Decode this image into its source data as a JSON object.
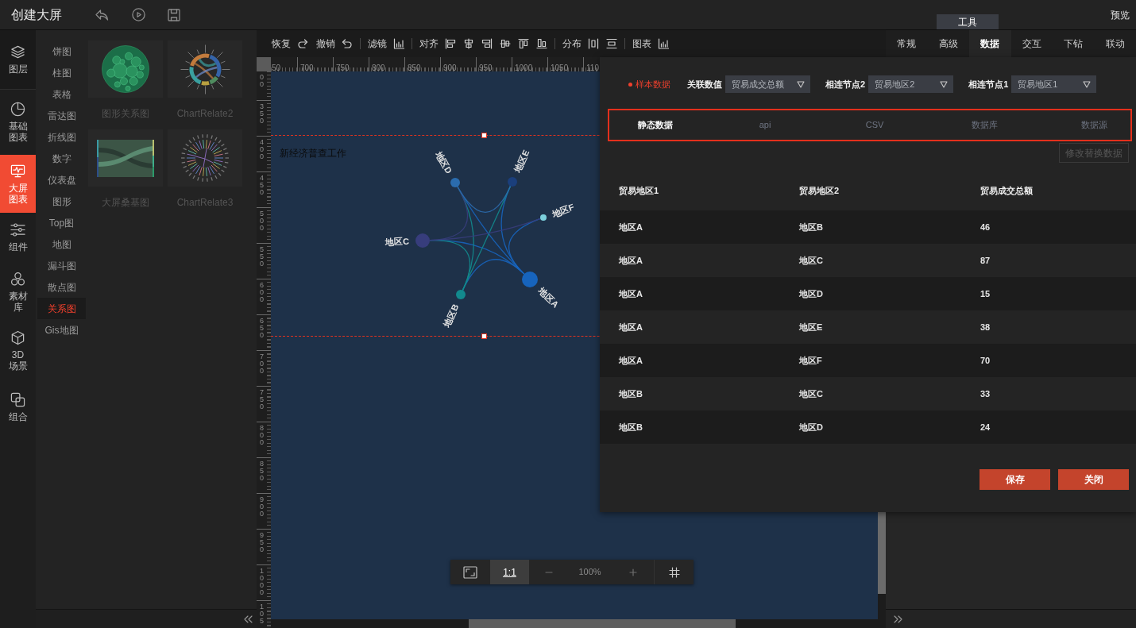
{
  "header": {
    "title": "创建大屏",
    "tool_tab": "工具",
    "preview": "预览"
  },
  "rail": [
    {
      "label": "图层",
      "selected": false
    },
    {
      "label": "基础图表",
      "selected": false
    },
    {
      "label": "大屏图表",
      "selected": true
    },
    {
      "label": "组件",
      "selected": false
    },
    {
      "label": "素材库",
      "selected": false
    },
    {
      "label": "3D场景",
      "selected": false
    },
    {
      "label": "组合",
      "selected": false
    }
  ],
  "categories": [
    {
      "label": "饼图",
      "selected": false
    },
    {
      "label": "柱图",
      "selected": false
    },
    {
      "label": "表格",
      "selected": false
    },
    {
      "label": "雷达图",
      "selected": false
    },
    {
      "label": "折线图",
      "selected": false
    },
    {
      "label": "数字",
      "selected": false
    },
    {
      "label": "仪表盘",
      "selected": false
    },
    {
      "label": "图形",
      "selected": false
    },
    {
      "label": "Top图",
      "selected": false
    },
    {
      "label": "地图",
      "selected": false
    },
    {
      "label": "漏斗图",
      "selected": false
    },
    {
      "label": "散点图",
      "selected": false
    },
    {
      "label": "关系图",
      "selected": true
    },
    {
      "label": "Gis地图",
      "selected": false
    }
  ],
  "templates": [
    {
      "name": "图形关系图"
    },
    {
      "name": "ChartRelate2"
    },
    {
      "name": "大屏桑基图"
    },
    {
      "name": "ChartRelate3"
    }
  ],
  "toolbar": [
    {
      "label": "恢复"
    },
    {
      "label": "撤销"
    },
    {
      "label": "滤镜"
    },
    {
      "label": "对齐"
    },
    {
      "label": "分布"
    },
    {
      "label": "图表"
    }
  ],
  "property_tabs": [
    {
      "label": "常规",
      "selected": false
    },
    {
      "label": "高级",
      "selected": false
    },
    {
      "label": "数据",
      "selected": true
    },
    {
      "label": "交互",
      "selected": false
    },
    {
      "label": "下钻",
      "selected": false
    },
    {
      "label": "联动",
      "selected": false
    }
  ],
  "rulers": {
    "x_labels": [
      "50",
      "700",
      "750",
      "800",
      "850",
      "900",
      "950",
      "1000",
      "1050",
      "110"
    ],
    "y_labels": [
      "00",
      "350",
      "400",
      "450",
      "500",
      "550",
      "600",
      "650",
      "700",
      "750",
      "800",
      "850",
      "900",
      "950",
      "1000",
      "105"
    ]
  },
  "canvas": {
    "label": "新经济普查工作",
    "graph": {
      "nodes": [
        {
          "label": "地区D",
          "color": "#2b6cae"
        },
        {
          "label": "地区E",
          "color": "#1b3f7c"
        },
        {
          "label": "地区F",
          "color": "#7ccfdc"
        },
        {
          "label": "地区C",
          "color": "#373d7c"
        },
        {
          "label": "地区A",
          "color": "#1764bd"
        },
        {
          "label": "地区B",
          "color": "#12898d"
        }
      ]
    }
  },
  "zoom_bar": {
    "actual_size": {
      "label": "1:1",
      "active": true
    },
    "zoom": "100%"
  },
  "data_panel": {
    "sample_tag": "样本数据",
    "fields": [
      {
        "label": "关联数值",
        "value": "贸易成交总额"
      },
      {
        "label": "相连节点2",
        "value": "贸易地区2"
      },
      {
        "label": "相连节点1",
        "value": "贸易地区1"
      }
    ],
    "source_tabs": [
      {
        "label": "静态数据",
        "selected": true
      },
      {
        "label": "api",
        "selected": false
      },
      {
        "label": "CSV",
        "selected": false
      },
      {
        "label": "数据库",
        "selected": false
      },
      {
        "label": "数据源",
        "selected": false
      }
    ],
    "replace_button": {
      "label": "修改替换数据",
      "disabled": true
    },
    "table": {
      "columns": [
        "贸易地区1",
        "贸易地区2",
        "贸易成交总额"
      ],
      "rows": [
        [
          "地区A",
          "地区B",
          "46"
        ],
        [
          "地区A",
          "地区C",
          "87"
        ],
        [
          "地区A",
          "地区D",
          "15"
        ],
        [
          "地区A",
          "地区E",
          "38"
        ],
        [
          "地区A",
          "地区F",
          "70"
        ],
        [
          "地区B",
          "地区C",
          "33"
        ],
        [
          "地区B",
          "地区D",
          "24"
        ]
      ]
    },
    "buttons": [
      {
        "label": "保存"
      },
      {
        "label": "关闭"
      }
    ]
  }
}
